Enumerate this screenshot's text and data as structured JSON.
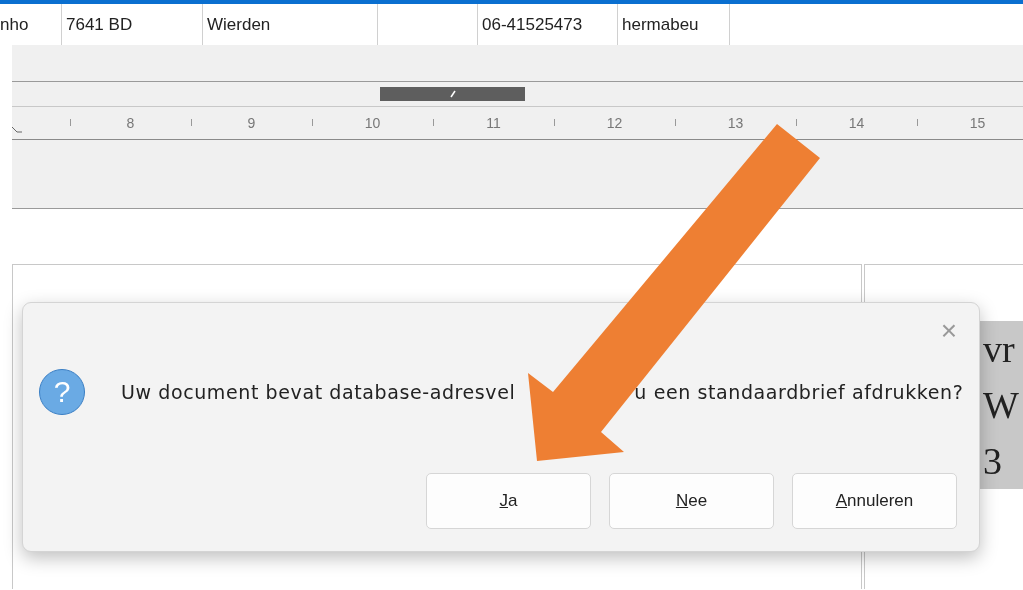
{
  "table_row": {
    "cells": [
      {
        "kind": "text",
        "text": "nho"
      },
      {
        "kind": "text",
        "text": "7641 BD"
      },
      {
        "kind": "text",
        "text": "Wierden"
      },
      {
        "kind": "blank"
      },
      {
        "kind": "text",
        "text": "06-41525473"
      },
      {
        "kind": "text",
        "text": "hermabeu"
      }
    ]
  },
  "ruler": {
    "labels": [
      "8",
      "9",
      "10",
      "11",
      "12",
      "13",
      "14",
      "15"
    ]
  },
  "document": {
    "lines": [
      "vr",
      "W",
      "3"
    ]
  },
  "dialog": {
    "close": "×",
    "icon": "?",
    "message_parts": [
      "Uw document bevat database-adresvel",
      "u een standaardbrief afdrukken?"
    ],
    "buttons": [
      {
        "mnemonic": "J",
        "rest": "a"
      },
      {
        "mnemonic": "N",
        "rest": "ee"
      },
      {
        "mnemonic": "A",
        "rest": "nnuleren"
      }
    ]
  }
}
